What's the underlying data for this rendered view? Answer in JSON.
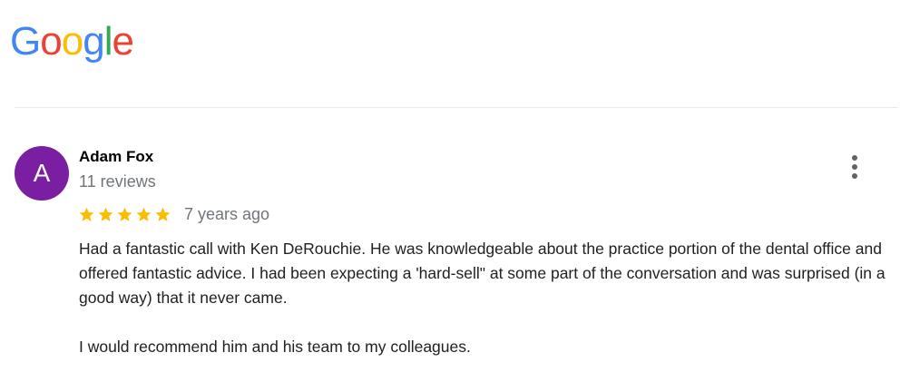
{
  "header": {
    "logo": {
      "letters": [
        {
          "char": "G",
          "color": "#4285F4"
        },
        {
          "char": "o",
          "color": "#EA4335"
        },
        {
          "char": "o",
          "color": "#FBBC05"
        },
        {
          "char": "g",
          "color": "#4285F4"
        },
        {
          "char": "l",
          "color": "#34A853"
        },
        {
          "char": "e",
          "color": "#EA4335"
        }
      ]
    }
  },
  "review": {
    "avatar_letter": "A",
    "avatar_color": "#7B1FA2",
    "author_name": "Adam Fox",
    "review_count": "11 reviews",
    "rating": 5,
    "rating_max": 5,
    "star_color": "#FBBC04",
    "time_ago": "7 years ago",
    "paragraphs": [
      "Had a fantastic call with Ken DeRouchie. He was knowledgeable about the practice portion of the dental office and offered fantastic advice.  I had been expecting a 'hard-sell\" at some part of the conversation and was surprised (in a good way) that it never came.",
      "I would recommend him and his team to my colleagues."
    ],
    "menu_icon": "more-vert-icon"
  }
}
